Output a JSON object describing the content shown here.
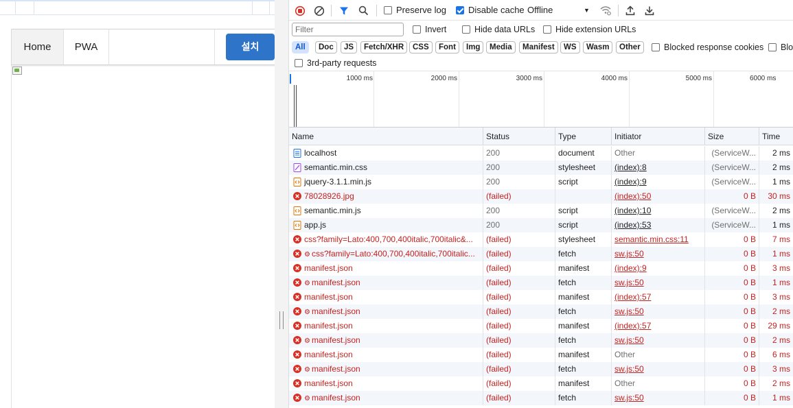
{
  "site": {
    "menu": {
      "home": "Home",
      "pwa": "PWA"
    },
    "install_label": "설치"
  },
  "devtools": {
    "toolbar": {
      "preserve_log": "Preserve log",
      "preserve_log_checked": false,
      "disable_cache": "Disable cache",
      "disable_cache_checked": true,
      "throttle": "Offline"
    },
    "filter": {
      "placeholder": "Filter",
      "invert": "Invert",
      "hide_data_urls": "Hide data URLs",
      "hide_extension_urls": "Hide extension URLs"
    },
    "type_filters": [
      "All",
      "Doc",
      "JS",
      "Fetch/XHR",
      "CSS",
      "Font",
      "Img",
      "Media",
      "Manifest",
      "WS",
      "Wasm",
      "Other"
    ],
    "active_type_filter": "All",
    "blocked_response_cookies": "Blocked response cookies",
    "blocked_requests_truncated": "Blo",
    "third_party": "3rd-party requests",
    "overview_ticks": [
      "1000 ms",
      "2000 ms",
      "3000 ms",
      "4000 ms",
      "5000 ms",
      "6000 ms"
    ],
    "table": {
      "headers": {
        "name": "Name",
        "status": "Status",
        "type": "Type",
        "initiator": "Initiator",
        "size": "Size",
        "time": "Time"
      },
      "rows": [
        {
          "icon": "document-icon",
          "gear": false,
          "name": "localhost",
          "status": "200",
          "type": "document",
          "initiator": "Other",
          "initiator_link": false,
          "size": "(ServiceW...",
          "time": "2 ms",
          "failed": false
        },
        {
          "icon": "stylesheet-icon",
          "gear": false,
          "name": "semantic.min.css",
          "status": "200",
          "type": "stylesheet",
          "initiator": "(index):8",
          "initiator_link": true,
          "size": "(ServiceW...",
          "time": "2 ms",
          "failed": false
        },
        {
          "icon": "script-icon",
          "gear": false,
          "name": "jquery-3.1.1.min.js",
          "status": "200",
          "type": "script",
          "initiator": "(index):9",
          "initiator_link": true,
          "size": "(ServiceW...",
          "time": "1 ms",
          "failed": false
        },
        {
          "icon": "error-icon",
          "gear": false,
          "name": "78028926.jpg",
          "status": "(failed)",
          "type": "",
          "initiator": "(index):50",
          "initiator_link": true,
          "size": "0 B",
          "time": "30 ms",
          "failed": true
        },
        {
          "icon": "script-icon",
          "gear": false,
          "name": "semantic.min.js",
          "status": "200",
          "type": "script",
          "initiator": "(index):10",
          "initiator_link": true,
          "size": "(ServiceW...",
          "time": "2 ms",
          "failed": false
        },
        {
          "icon": "script-icon",
          "gear": false,
          "name": "app.js",
          "status": "200",
          "type": "script",
          "initiator": "(index):53",
          "initiator_link": true,
          "size": "(ServiceW...",
          "time": "1 ms",
          "failed": false
        },
        {
          "icon": "error-icon",
          "gear": false,
          "name": "css?family=Lato:400,700,400italic,700italic&...",
          "status": "(failed)",
          "type": "stylesheet",
          "initiator": "semantic.min.css:11",
          "initiator_link": true,
          "size": "0 B",
          "time": "7 ms",
          "failed": true
        },
        {
          "icon": "error-icon",
          "gear": true,
          "name": "css?family=Lato:400,700,400italic,700italic...",
          "status": "(failed)",
          "type": "fetch",
          "initiator": "sw.js:50",
          "initiator_link": true,
          "size": "0 B",
          "time": "1 ms",
          "failed": true
        },
        {
          "icon": "error-icon",
          "gear": false,
          "name": "manifest.json",
          "status": "(failed)",
          "type": "manifest",
          "initiator": "(index):9",
          "initiator_link": true,
          "size": "0 B",
          "time": "3 ms",
          "failed": true
        },
        {
          "icon": "error-icon",
          "gear": true,
          "name": "manifest.json",
          "status": "(failed)",
          "type": "fetch",
          "initiator": "sw.js:50",
          "initiator_link": true,
          "size": "0 B",
          "time": "1 ms",
          "failed": true
        },
        {
          "icon": "error-icon",
          "gear": false,
          "name": "manifest.json",
          "status": "(failed)",
          "type": "manifest",
          "initiator": "(index):57",
          "initiator_link": true,
          "size": "0 B",
          "time": "3 ms",
          "failed": true
        },
        {
          "icon": "error-icon",
          "gear": true,
          "name": "manifest.json",
          "status": "(failed)",
          "type": "fetch",
          "initiator": "sw.js:50",
          "initiator_link": true,
          "size": "0 B",
          "time": "2 ms",
          "failed": true
        },
        {
          "icon": "error-icon",
          "gear": false,
          "name": "manifest.json",
          "status": "(failed)",
          "type": "manifest",
          "initiator": "(index):57",
          "initiator_link": true,
          "size": "0 B",
          "time": "29 ms",
          "failed": true
        },
        {
          "icon": "error-icon",
          "gear": true,
          "name": "manifest.json",
          "status": "(failed)",
          "type": "fetch",
          "initiator": "sw.js:50",
          "initiator_link": true,
          "size": "0 B",
          "time": "2 ms",
          "failed": true
        },
        {
          "icon": "error-icon",
          "gear": false,
          "name": "manifest.json",
          "status": "(failed)",
          "type": "manifest",
          "initiator": "Other",
          "initiator_link": false,
          "size": "0 B",
          "time": "6 ms",
          "failed": true
        },
        {
          "icon": "error-icon",
          "gear": true,
          "name": "manifest.json",
          "status": "(failed)",
          "type": "fetch",
          "initiator": "sw.js:50",
          "initiator_link": true,
          "size": "0 B",
          "time": "3 ms",
          "failed": true
        },
        {
          "icon": "error-icon",
          "gear": false,
          "name": "manifest.json",
          "status": "(failed)",
          "type": "manifest",
          "initiator": "Other",
          "initiator_link": false,
          "size": "0 B",
          "time": "2 ms",
          "failed": true
        },
        {
          "icon": "error-icon",
          "gear": true,
          "name": "manifest.json",
          "status": "(failed)",
          "type": "fetch",
          "initiator": "sw.js:50",
          "initiator_link": true,
          "size": "0 B",
          "time": "1 ms",
          "failed": true
        }
      ]
    },
    "colors": {
      "record_stop": "#d93025",
      "filter_active": "#1a73e8",
      "failed_text": "#c5221f",
      "chip_active_bg": "#d3e3fd",
      "install_button": "#2e74c9"
    }
  }
}
